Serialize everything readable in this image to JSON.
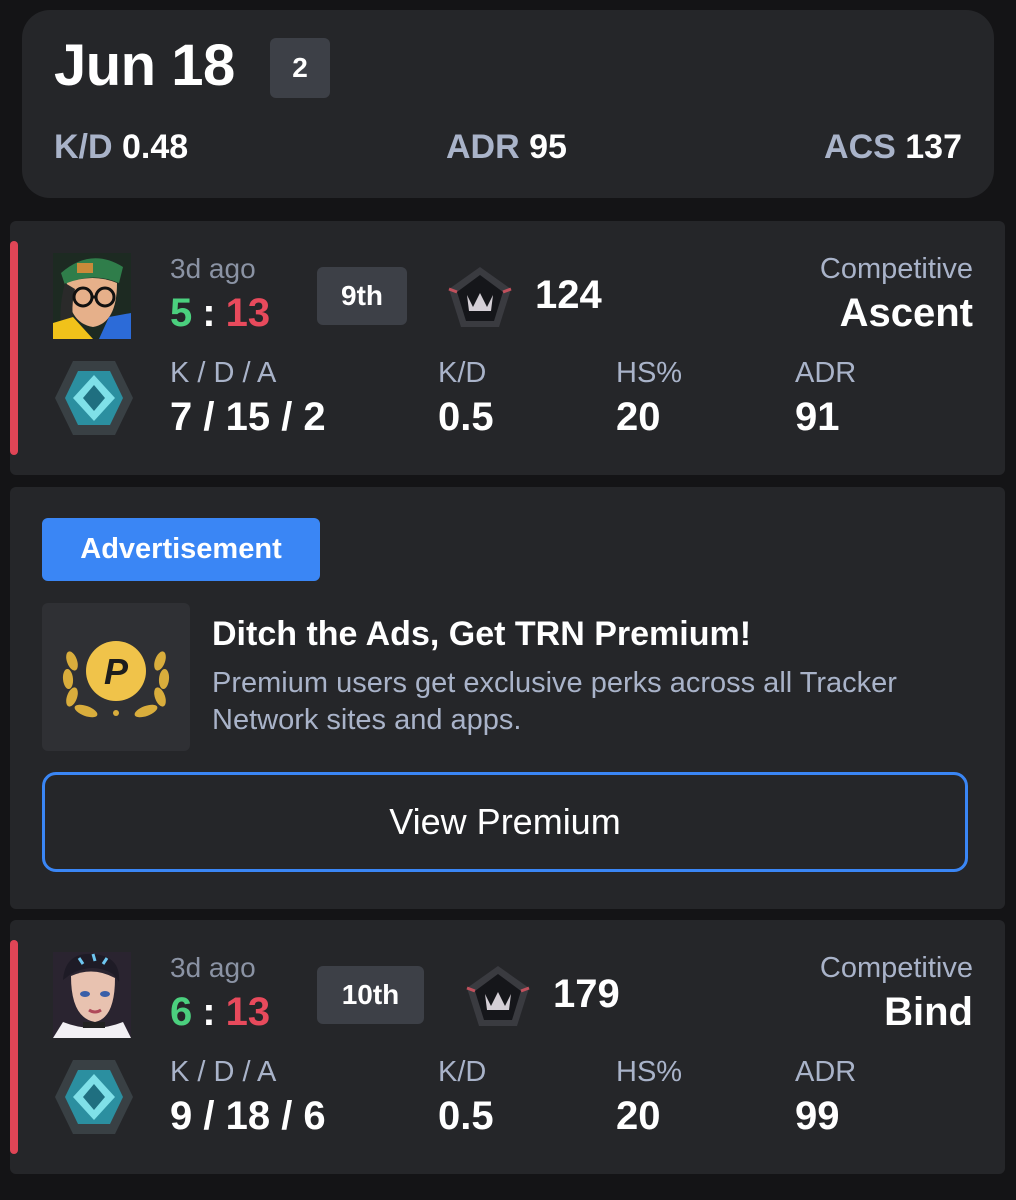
{
  "summary": {
    "date": "Jun 18",
    "match_count": "2",
    "kd_label": "K/D",
    "kd_value": "0.48",
    "adr_label": "ADR",
    "adr_value": "95",
    "acs_label": "ACS",
    "acs_value": "137"
  },
  "matches": [
    {
      "ago": "3d ago",
      "score_won": "5",
      "score_sep": ":",
      "score_lost": "13",
      "placement": "9th",
      "rr": "124",
      "mode": "Competitive",
      "map": "Ascent",
      "kda_label": "K / D / A",
      "kda_value": "7 / 15 / 2",
      "kd_label": "K/D",
      "kd_value": "0.5",
      "hs_label": "HS%",
      "hs_value": "20",
      "adr_label": "ADR",
      "adr_value": "91"
    },
    {
      "ago": "3d ago",
      "score_won": "6",
      "score_sep": ":",
      "score_lost": "13",
      "placement": "10th",
      "rr": "179",
      "mode": "Competitive",
      "map": "Bind",
      "kda_label": "K / D / A",
      "kda_value": "9 / 18 / 6",
      "kd_label": "K/D",
      "kd_value": "0.5",
      "hs_label": "HS%",
      "hs_value": "20",
      "adr_label": "ADR",
      "adr_value": "99"
    }
  ],
  "ad": {
    "badge": "Advertisement",
    "title": "Ditch the Ads, Get TRN Premium!",
    "description": "Premium users get exclusive perks across all Tracker Network sites and apps.",
    "button": "View Premium",
    "logo_letter": "P"
  },
  "colors": {
    "background": "#141416",
    "card": "#252629",
    "win": "#4bd07e",
    "loss": "#e84a5c",
    "accent": "#3a86f5",
    "muted": "#a9b3c9"
  },
  "icons": [
    "agent-portrait-icon",
    "rank-emblem-icon",
    "crown-pentagon-icon",
    "premium-laurel-icon"
  ]
}
